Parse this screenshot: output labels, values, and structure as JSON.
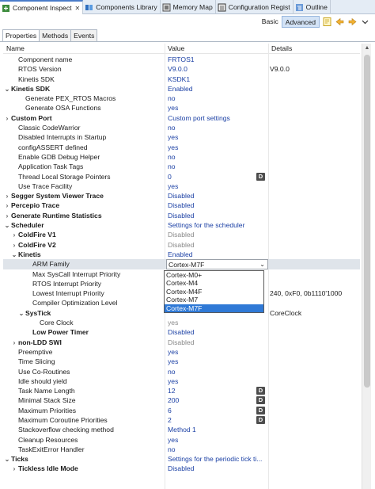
{
  "view_tabs": [
    {
      "label": "Component Inspect",
      "icon": "component-icon",
      "active": true,
      "close": "✕"
    },
    {
      "label": "Components Library",
      "icon": "library-icon"
    },
    {
      "label": "Memory Map",
      "icon": "memory-map-icon"
    },
    {
      "label": "Configuration Regist",
      "icon": "registers-icon"
    },
    {
      "label": "Outline",
      "icon": "outline-icon"
    }
  ],
  "toolbar": {
    "basic_label": "Basic",
    "advanced_label": "Advanced"
  },
  "prop_tabs": [
    "Properties",
    "Methods",
    "Events"
  ],
  "columns": {
    "name": "Name",
    "value": "Value",
    "details": "Details"
  },
  "rows": [
    {
      "name": "Component name",
      "value": "FRTOS1",
      "indent": 1
    },
    {
      "name": "RTOS Version",
      "value": "V9.0.0",
      "details": "V9.0.0",
      "indent": 1
    },
    {
      "name": "Kinetis SDK",
      "value": "KSDK1",
      "indent": 1
    },
    {
      "name": "Kinetis SDK",
      "value": "Enabled",
      "indent": 0,
      "bold": true,
      "twisty": "open"
    },
    {
      "name": "Generate PEX_RTOS Macros",
      "value": "no",
      "indent": 2
    },
    {
      "name": "Generate OSA Functions",
      "value": "yes",
      "indent": 2
    },
    {
      "name": "Custom Port",
      "value": "Custom port settings",
      "indent": 0,
      "bold": true,
      "twisty": "closed"
    },
    {
      "name": "Classic CodeWarrior",
      "value": "no",
      "indent": 1
    },
    {
      "name": "Disabled Interrupts in Startup",
      "value": "yes",
      "indent": 1
    },
    {
      "name": "configASSERT defined",
      "value": "yes",
      "indent": 1
    },
    {
      "name": "Enable GDB Debug Helper",
      "value": "no",
      "indent": 1
    },
    {
      "name": "Application Task Tags",
      "value": "no",
      "indent": 1
    },
    {
      "name": "Thread Local Storage Pointers",
      "value": "0",
      "indent": 1,
      "dbtn": "D"
    },
    {
      "name": "Use Trace Facility",
      "value": "yes",
      "indent": 1
    },
    {
      "name": "Segger System Viewer Trace",
      "value": "Disabled",
      "indent": 0,
      "bold": true,
      "twisty": "closed"
    },
    {
      "name": "Percepio Trace",
      "value": "Disabled",
      "indent": 0,
      "bold": true,
      "twisty": "closed"
    },
    {
      "name": "Generate Runtime Statistics",
      "value": "Disabled",
      "indent": 0,
      "bold": true,
      "twisty": "closed"
    },
    {
      "name": "Scheduler",
      "value": "Settings for the scheduler",
      "indent": 0,
      "bold": true,
      "twisty": "open"
    },
    {
      "name": "ColdFire V1",
      "value": "Disabled",
      "indent": 1,
      "bold": true,
      "twisty": "closed",
      "disabled": true
    },
    {
      "name": "ColdFire V2",
      "value": "Disabled",
      "indent": 1,
      "bold": true,
      "twisty": "closed",
      "disabled": true
    },
    {
      "name": "Kinetis",
      "value": "Enabled",
      "indent": 1,
      "bold": true,
      "twisty": "open"
    },
    {
      "name": "ARM Family",
      "value": "Cortex-M7F",
      "indent": 3,
      "combo": true,
      "highlight": true
    },
    {
      "name": "Max SysCall Interrupt Priority",
      "value": "",
      "indent": 3
    },
    {
      "name": "RTOS Interrupt Priority",
      "value": "",
      "indent": 3
    },
    {
      "name": "Lowest Interrupt Priority",
      "value": "",
      "details": "240, 0xF0, 0b1110'1000",
      "indent": 3
    },
    {
      "name": "Compiler Optimization Level",
      "value": "",
      "indent": 3
    },
    {
      "name": "SysTick",
      "value": "",
      "details": "CoreClock",
      "indent": 2,
      "bold": true,
      "twisty": "open"
    },
    {
      "name": "Core Clock",
      "value": "yes",
      "indent": 4,
      "disabled": true
    },
    {
      "name": "Low Power Timer",
      "value": "Disabled",
      "indent": 3,
      "bold": true
    },
    {
      "name": "non-LDD SWI",
      "value": "Disabled",
      "indent": 1,
      "bold": true,
      "twisty": "closed",
      "disabled": true
    },
    {
      "name": "Preemptive",
      "value": "yes",
      "indent": 1
    },
    {
      "name": "Time Slicing",
      "value": "yes",
      "indent": 1
    },
    {
      "name": "Use Co-Routines",
      "value": "no",
      "indent": 1
    },
    {
      "name": "Idle should yield",
      "value": "yes",
      "indent": 1
    },
    {
      "name": "Task Name Length",
      "value": "12",
      "indent": 1,
      "dbtn": "D"
    },
    {
      "name": "Minimal Stack Size",
      "value": "200",
      "indent": 1,
      "dbtn": "D"
    },
    {
      "name": "Maximum Priorities",
      "value": "6",
      "indent": 1,
      "dbtn": "D"
    },
    {
      "name": "Maximum Coroutine Priorities",
      "value": "2",
      "indent": 1,
      "dbtn": "D"
    },
    {
      "name": "Stackoverflow checking method",
      "value": "Method 1",
      "indent": 1
    },
    {
      "name": "Cleanup Resources",
      "value": "yes",
      "indent": 1
    },
    {
      "name": "TaskExitError Handler",
      "value": "no",
      "indent": 1
    },
    {
      "name": "Ticks",
      "value": "Settings for the periodic tick ti...",
      "indent": 0,
      "bold": true,
      "twisty": "open"
    },
    {
      "name": "Tickless Idle Mode",
      "value": "Disabled",
      "indent": 1,
      "bold": true,
      "twisty": "closed"
    }
  ],
  "dropdown": {
    "options": [
      "Cortex-M0+",
      "Cortex-M4",
      "Cortex-M4F",
      "Cortex-M7",
      "Cortex-M7F"
    ],
    "selected": "Cortex-M7F",
    "arrow": "⌄"
  },
  "colors": {
    "value_text": "#1a3fa4",
    "selection": "#2f79d6",
    "tab_accent": "#4a7cc8"
  }
}
